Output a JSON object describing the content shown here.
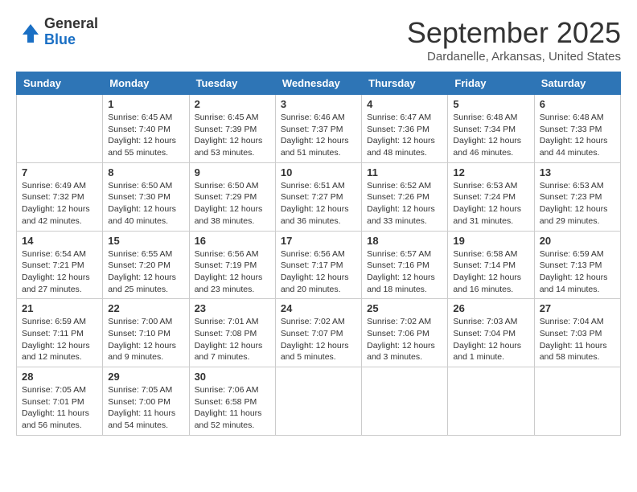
{
  "logo": {
    "general": "General",
    "blue": "Blue"
  },
  "title": "September 2025",
  "subtitle": "Dardanelle, Arkansas, United States",
  "weekdays": [
    "Sunday",
    "Monday",
    "Tuesday",
    "Wednesday",
    "Thursday",
    "Friday",
    "Saturday"
  ],
  "weeks": [
    [
      {
        "day": "",
        "sunrise": "",
        "sunset": "",
        "daylight": ""
      },
      {
        "day": "1",
        "sunrise": "Sunrise: 6:45 AM",
        "sunset": "Sunset: 7:40 PM",
        "daylight": "Daylight: 12 hours and 55 minutes."
      },
      {
        "day": "2",
        "sunrise": "Sunrise: 6:45 AM",
        "sunset": "Sunset: 7:39 PM",
        "daylight": "Daylight: 12 hours and 53 minutes."
      },
      {
        "day": "3",
        "sunrise": "Sunrise: 6:46 AM",
        "sunset": "Sunset: 7:37 PM",
        "daylight": "Daylight: 12 hours and 51 minutes."
      },
      {
        "day": "4",
        "sunrise": "Sunrise: 6:47 AM",
        "sunset": "Sunset: 7:36 PM",
        "daylight": "Daylight: 12 hours and 48 minutes."
      },
      {
        "day": "5",
        "sunrise": "Sunrise: 6:48 AM",
        "sunset": "Sunset: 7:34 PM",
        "daylight": "Daylight: 12 hours and 46 minutes."
      },
      {
        "day": "6",
        "sunrise": "Sunrise: 6:48 AM",
        "sunset": "Sunset: 7:33 PM",
        "daylight": "Daylight: 12 hours and 44 minutes."
      }
    ],
    [
      {
        "day": "7",
        "sunrise": "Sunrise: 6:49 AM",
        "sunset": "Sunset: 7:32 PM",
        "daylight": "Daylight: 12 hours and 42 minutes."
      },
      {
        "day": "8",
        "sunrise": "Sunrise: 6:50 AM",
        "sunset": "Sunset: 7:30 PM",
        "daylight": "Daylight: 12 hours and 40 minutes."
      },
      {
        "day": "9",
        "sunrise": "Sunrise: 6:50 AM",
        "sunset": "Sunset: 7:29 PM",
        "daylight": "Daylight: 12 hours and 38 minutes."
      },
      {
        "day": "10",
        "sunrise": "Sunrise: 6:51 AM",
        "sunset": "Sunset: 7:27 PM",
        "daylight": "Daylight: 12 hours and 36 minutes."
      },
      {
        "day": "11",
        "sunrise": "Sunrise: 6:52 AM",
        "sunset": "Sunset: 7:26 PM",
        "daylight": "Daylight: 12 hours and 33 minutes."
      },
      {
        "day": "12",
        "sunrise": "Sunrise: 6:53 AM",
        "sunset": "Sunset: 7:24 PM",
        "daylight": "Daylight: 12 hours and 31 minutes."
      },
      {
        "day": "13",
        "sunrise": "Sunrise: 6:53 AM",
        "sunset": "Sunset: 7:23 PM",
        "daylight": "Daylight: 12 hours and 29 minutes."
      }
    ],
    [
      {
        "day": "14",
        "sunrise": "Sunrise: 6:54 AM",
        "sunset": "Sunset: 7:21 PM",
        "daylight": "Daylight: 12 hours and 27 minutes."
      },
      {
        "day": "15",
        "sunrise": "Sunrise: 6:55 AM",
        "sunset": "Sunset: 7:20 PM",
        "daylight": "Daylight: 12 hours and 25 minutes."
      },
      {
        "day": "16",
        "sunrise": "Sunrise: 6:56 AM",
        "sunset": "Sunset: 7:19 PM",
        "daylight": "Daylight: 12 hours and 23 minutes."
      },
      {
        "day": "17",
        "sunrise": "Sunrise: 6:56 AM",
        "sunset": "Sunset: 7:17 PM",
        "daylight": "Daylight: 12 hours and 20 minutes."
      },
      {
        "day": "18",
        "sunrise": "Sunrise: 6:57 AM",
        "sunset": "Sunset: 7:16 PM",
        "daylight": "Daylight: 12 hours and 18 minutes."
      },
      {
        "day": "19",
        "sunrise": "Sunrise: 6:58 AM",
        "sunset": "Sunset: 7:14 PM",
        "daylight": "Daylight: 12 hours and 16 minutes."
      },
      {
        "day": "20",
        "sunrise": "Sunrise: 6:59 AM",
        "sunset": "Sunset: 7:13 PM",
        "daylight": "Daylight: 12 hours and 14 minutes."
      }
    ],
    [
      {
        "day": "21",
        "sunrise": "Sunrise: 6:59 AM",
        "sunset": "Sunset: 7:11 PM",
        "daylight": "Daylight: 12 hours and 12 minutes."
      },
      {
        "day": "22",
        "sunrise": "Sunrise: 7:00 AM",
        "sunset": "Sunset: 7:10 PM",
        "daylight": "Daylight: 12 hours and 9 minutes."
      },
      {
        "day": "23",
        "sunrise": "Sunrise: 7:01 AM",
        "sunset": "Sunset: 7:08 PM",
        "daylight": "Daylight: 12 hours and 7 minutes."
      },
      {
        "day": "24",
        "sunrise": "Sunrise: 7:02 AM",
        "sunset": "Sunset: 7:07 PM",
        "daylight": "Daylight: 12 hours and 5 minutes."
      },
      {
        "day": "25",
        "sunrise": "Sunrise: 7:02 AM",
        "sunset": "Sunset: 7:06 PM",
        "daylight": "Daylight: 12 hours and 3 minutes."
      },
      {
        "day": "26",
        "sunrise": "Sunrise: 7:03 AM",
        "sunset": "Sunset: 7:04 PM",
        "daylight": "Daylight: 12 hours and 1 minute."
      },
      {
        "day": "27",
        "sunrise": "Sunrise: 7:04 AM",
        "sunset": "Sunset: 7:03 PM",
        "daylight": "Daylight: 11 hours and 58 minutes."
      }
    ],
    [
      {
        "day": "28",
        "sunrise": "Sunrise: 7:05 AM",
        "sunset": "Sunset: 7:01 PM",
        "daylight": "Daylight: 11 hours and 56 minutes."
      },
      {
        "day": "29",
        "sunrise": "Sunrise: 7:05 AM",
        "sunset": "Sunset: 7:00 PM",
        "daylight": "Daylight: 11 hours and 54 minutes."
      },
      {
        "day": "30",
        "sunrise": "Sunrise: 7:06 AM",
        "sunset": "Sunset: 6:58 PM",
        "daylight": "Daylight: 11 hours and 52 minutes."
      },
      {
        "day": "",
        "sunrise": "",
        "sunset": "",
        "daylight": ""
      },
      {
        "day": "",
        "sunrise": "",
        "sunset": "",
        "daylight": ""
      },
      {
        "day": "",
        "sunrise": "",
        "sunset": "",
        "daylight": ""
      },
      {
        "day": "",
        "sunrise": "",
        "sunset": "",
        "daylight": ""
      }
    ]
  ]
}
